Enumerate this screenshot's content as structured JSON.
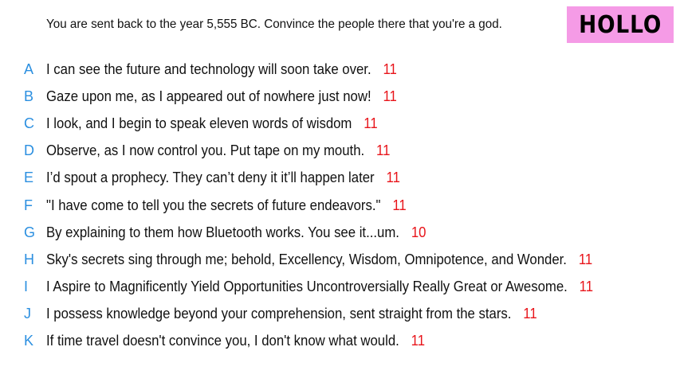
{
  "prompt": "You are sent back to the year 5,555 BC. Convince the people there that you're a god.",
  "logo": {
    "text": "HOLLO",
    "background": "#f59be6"
  },
  "colors": {
    "letter": "#2b8fe0",
    "count": "#e8141a",
    "text": "#111111"
  },
  "answers": [
    {
      "letter": "A",
      "text": "I can see the future and technology will soon take over.",
      "count": "11"
    },
    {
      "letter": "B",
      "text": "Gaze upon me, as I appeared out of nowhere just now!",
      "count": "11"
    },
    {
      "letter": "C",
      "text": "I look, and I begin to speak eleven words of wisdom",
      "count": "11"
    },
    {
      "letter": "D",
      "text": "Observe, as I now control you. Put tape on my mouth.",
      "count": "11"
    },
    {
      "letter": "E",
      "text": "I’d spout a prophecy. They can’t deny it it’ll happen later",
      "count": "11"
    },
    {
      "letter": "F",
      "text": "\"I have come to tell you the secrets of future endeavors.\"",
      "count": "11"
    },
    {
      "letter": "G",
      "text": "By explaining to them how Bluetooth works. You see it...um.",
      "count": "10"
    },
    {
      "letter": "H",
      "text": "Sky's secrets sing through me; behold, Excellency, Wisdom, Omnipotence, and Wonder.",
      "count": "11"
    },
    {
      "letter": "I",
      "text": "I Aspire to Magnificently Yield Opportunities Uncontroversially Really Great or Awesome.",
      "count": "11"
    },
    {
      "letter": "J",
      "text": "I possess knowledge beyond your comprehension, sent straight from the stars.",
      "count": "11"
    },
    {
      "letter": "K",
      "text": "If time travel doesn't convince you, I don't know what would.",
      "count": "11"
    }
  ]
}
